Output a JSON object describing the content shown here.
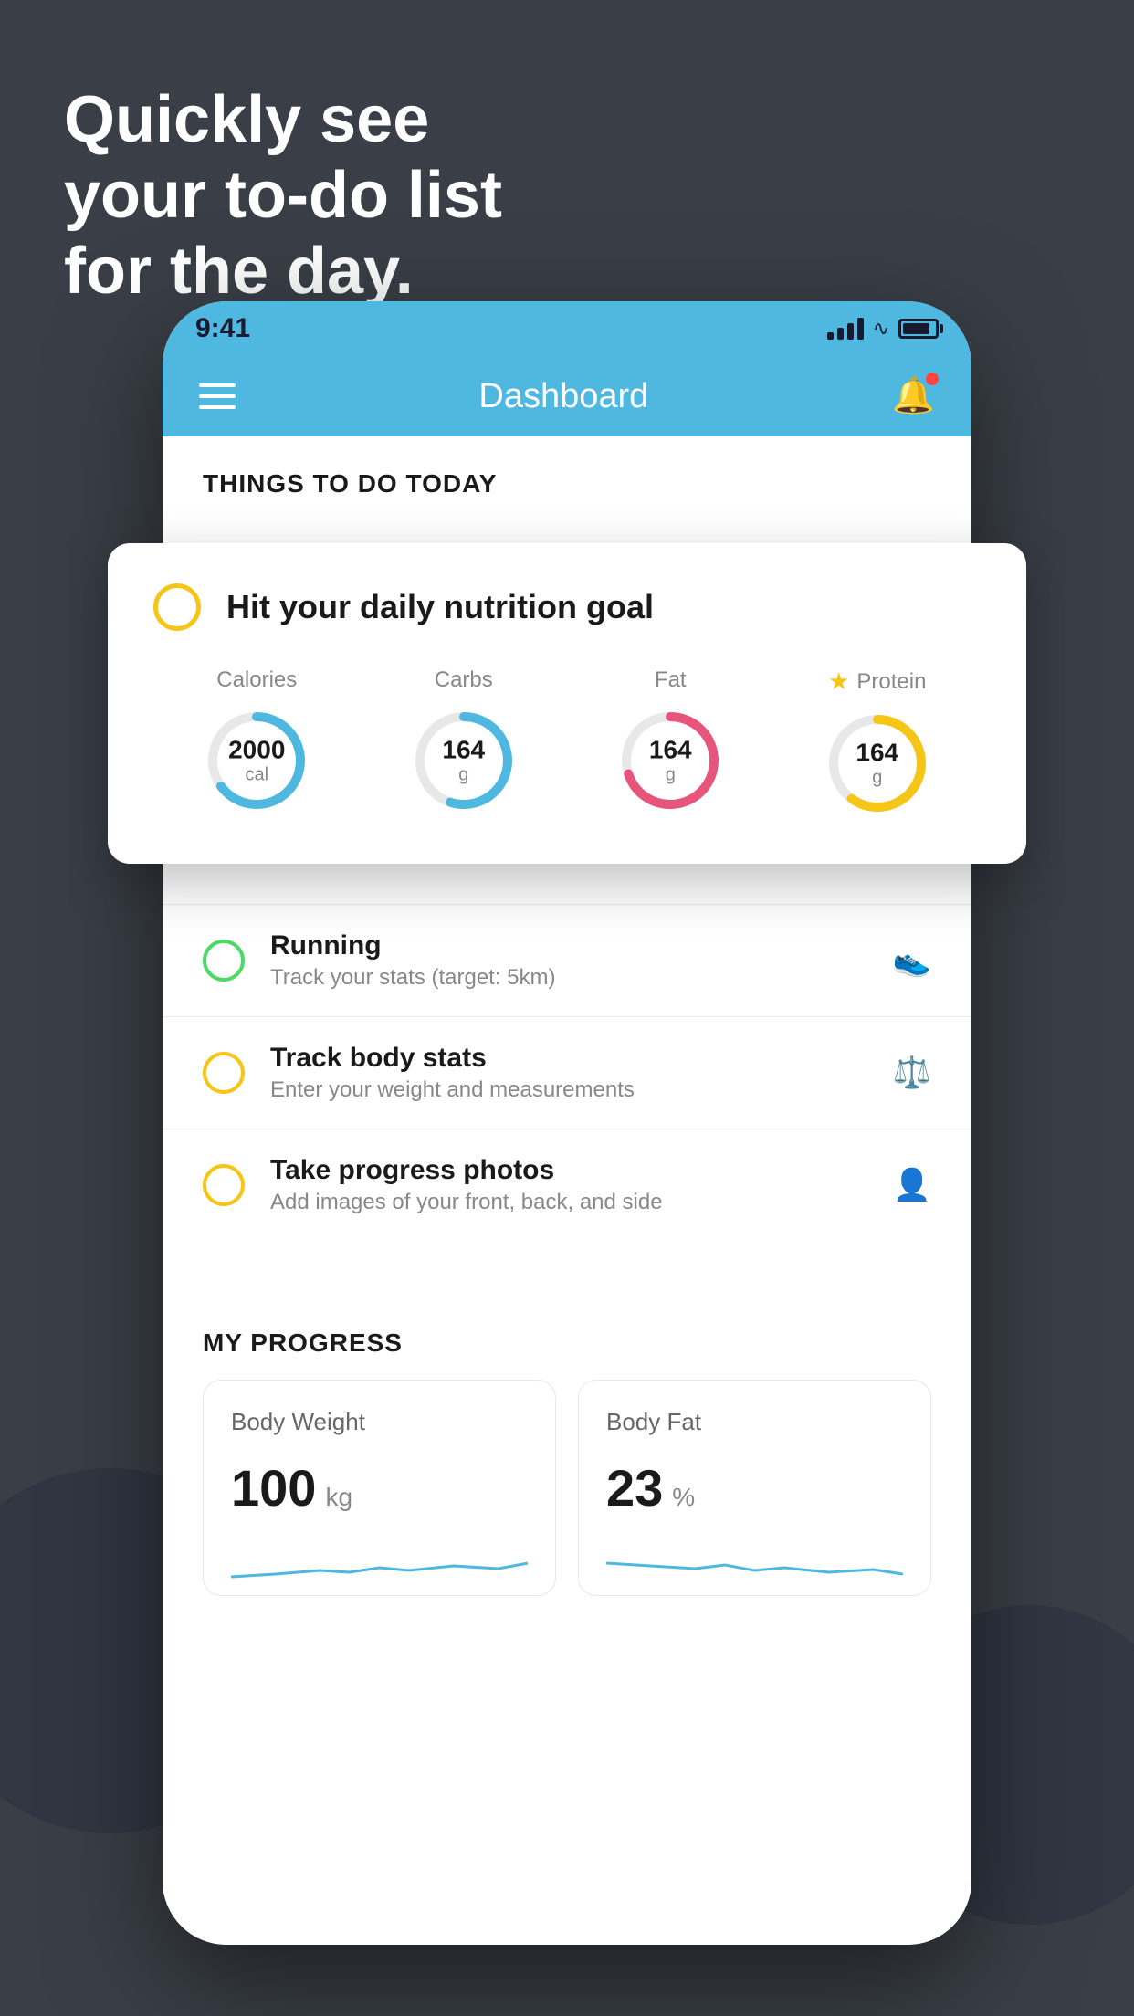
{
  "hero": {
    "line1": "Quickly see",
    "line2": "your to-do list",
    "line3": "for the day."
  },
  "statusBar": {
    "time": "9:41"
  },
  "navBar": {
    "title": "Dashboard"
  },
  "thingsToDoSection": {
    "header": "THINGS TO DO TODAY"
  },
  "nutritionCard": {
    "checkCircleColor": "#f5c518",
    "title": "Hit your daily nutrition goal",
    "items": [
      {
        "label": "Calories",
        "value": "2000",
        "unit": "cal",
        "color": "#4fb8e0",
        "progress": 0.65,
        "starred": false
      },
      {
        "label": "Carbs",
        "value": "164",
        "unit": "g",
        "color": "#4fb8e0",
        "progress": 0.55,
        "starred": false
      },
      {
        "label": "Fat",
        "value": "164",
        "unit": "g",
        "color": "#e8557a",
        "progress": 0.7,
        "starred": false
      },
      {
        "label": "Protein",
        "value": "164",
        "unit": "g",
        "color": "#f5c518",
        "progress": 0.6,
        "starred": true
      }
    ]
  },
  "todoItems": [
    {
      "id": "running",
      "circleColor": "green",
      "title": "Running",
      "subtitle": "Track your stats (target: 5km)",
      "icon": "shoe"
    },
    {
      "id": "body-stats",
      "circleColor": "yellow",
      "title": "Track body stats",
      "subtitle": "Enter your weight and measurements",
      "icon": "scale"
    },
    {
      "id": "progress-photos",
      "circleColor": "yellow",
      "title": "Take progress photos",
      "subtitle": "Add images of your front, back, and side",
      "icon": "person"
    }
  ],
  "progressSection": {
    "header": "MY PROGRESS",
    "cards": [
      {
        "id": "body-weight",
        "title": "Body Weight",
        "value": "100",
        "unit": "kg"
      },
      {
        "id": "body-fat",
        "title": "Body Fat",
        "value": "23",
        "unit": "%"
      }
    ]
  }
}
